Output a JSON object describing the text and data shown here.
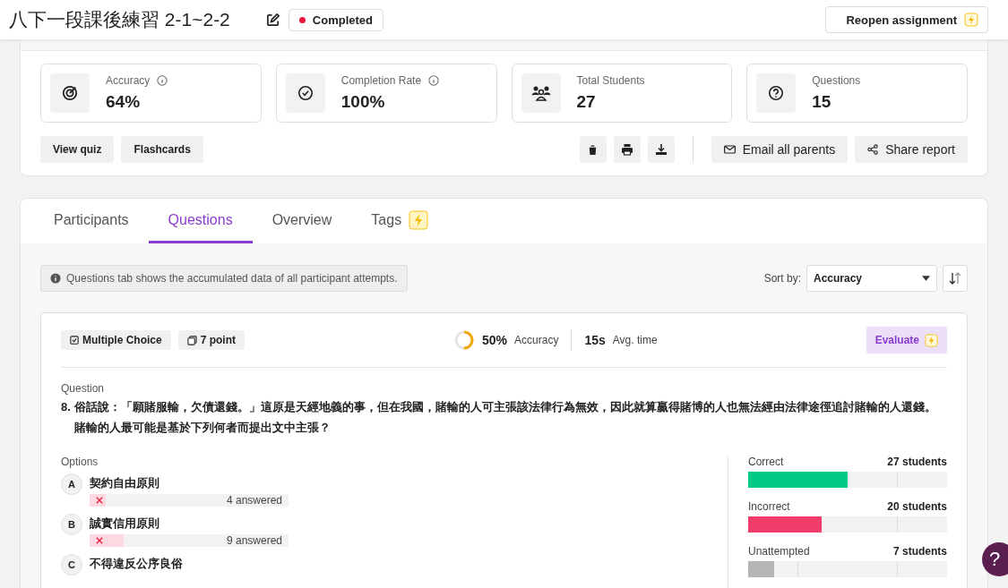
{
  "header": {
    "title": "八下一段課後練習 2-1~2-2",
    "status": {
      "label": "Completed",
      "color": "#e8173f"
    },
    "reopen_button": "Reopen assignment"
  },
  "stats": [
    {
      "kind": "accuracy",
      "label": "Accuracy",
      "value": "64%",
      "info": true
    },
    {
      "kind": "completion",
      "label": "Completion Rate",
      "value": "100%",
      "info": true
    },
    {
      "kind": "students",
      "label": "Total Students",
      "value": "27",
      "info": false
    },
    {
      "kind": "questions",
      "label": "Questions",
      "value": "15",
      "info": false
    }
  ],
  "actions": {
    "left": [
      "View quiz",
      "Flashcards"
    ],
    "email": "Email all parents",
    "share": "Share report"
  },
  "tabs": [
    {
      "label": "Participants",
      "selected": false,
      "badge": false
    },
    {
      "label": "Questions",
      "selected": true,
      "badge": false
    },
    {
      "label": "Overview",
      "selected": false,
      "badge": false
    },
    {
      "label": "Tags",
      "selected": false,
      "badge": true
    }
  ],
  "notice": "Questions tab shows the accumulated data of all participant attempts.",
  "sort": {
    "label": "Sort by:",
    "value": "Accuracy"
  },
  "question": {
    "type": "Multiple Choice",
    "points": "7 point",
    "accuracy": {
      "value": "50%",
      "label": "Accuracy",
      "level": 0.5
    },
    "avg_time": {
      "value": "15s",
      "label": "Avg. time"
    },
    "evaluate": "Evaluate",
    "heading": "Question",
    "number": "8.",
    "text": "俗話說：「願賭服輸，欠債還錢。」這原是天經地義的事，但在我國，賭輸的人可主張該法律行為無效，因此就算贏得賭博的人也無法經由法律途徑追討賭輸的人還錢。賭輸的人最可能是基於下列何者而提出文中主張？",
    "options_heading": "Options",
    "options": [
      {
        "letter": "A",
        "text": "契約自由原則",
        "correct": false,
        "level": 0.08,
        "answered": "4 answered"
      },
      {
        "letter": "B",
        "text": "誠實信用原則",
        "correct": false,
        "level": 0.17,
        "answered": "9 answered"
      },
      {
        "letter": "C",
        "text": "不得違反公序良俗"
      }
    ],
    "results": [
      {
        "label": "Correct",
        "count": "27 students",
        "level": 0.5,
        "color": "#00c985"
      },
      {
        "label": "Incorrect",
        "count": "20 students",
        "level": 0.37,
        "color": "#ef3c69"
      },
      {
        "label": "Unattempted",
        "count": "7 students",
        "level": 0.13,
        "color": "#b5b5b5"
      }
    ]
  },
  "help": "?"
}
